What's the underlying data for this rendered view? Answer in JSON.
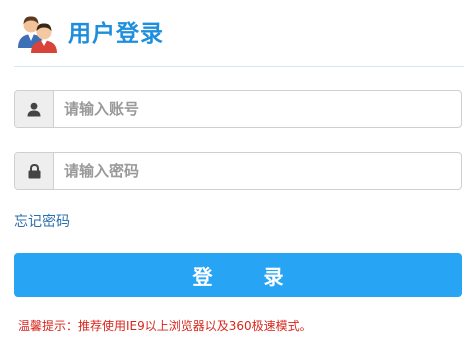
{
  "header": {
    "icon": "users-icon",
    "title": "用户登录"
  },
  "form": {
    "username": {
      "icon": "user-icon",
      "placeholder": "请输入账号",
      "value": ""
    },
    "password": {
      "icon": "lock-icon",
      "placeholder": "请输入密码",
      "value": ""
    },
    "forgot_link": "忘记密码",
    "login_button": "登 录"
  },
  "tip": "温馨提示：推荐使用IE9以上浏览器以及360极速模式。",
  "colors": {
    "accent": "#28a4f5",
    "title": "#1e8fdd",
    "link": "#2a6fb0",
    "warning": "#d9261c"
  }
}
